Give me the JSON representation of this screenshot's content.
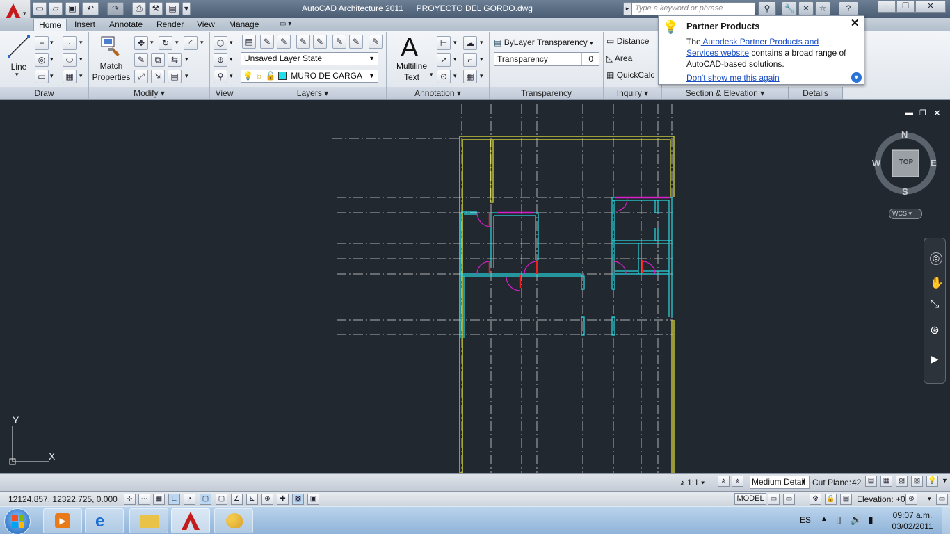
{
  "window": {
    "title": "AutoCAD Architecture 2011",
    "document": "PROYECTO DEL GORDO.dwg",
    "search_placeholder": "Type a keyword or phrase"
  },
  "tabs": [
    {
      "label": "Home"
    },
    {
      "label": "Insert"
    },
    {
      "label": "Annotate"
    },
    {
      "label": "Render"
    },
    {
      "label": "View"
    },
    {
      "label": "Manage"
    }
  ],
  "ribbon": {
    "panels": {
      "draw": "Draw",
      "modify": "Modify",
      "view": "View",
      "layers": "Layers",
      "annotation": "Annotation",
      "transparency": "Transparency",
      "inquiry": "Inquiry",
      "section": "Section & Elevation",
      "details": "Details"
    },
    "line_label": "Line",
    "match_label_1": "Match",
    "match_label_2": "Properties",
    "layer_state": "Unsaved Layer State",
    "current_layer": "MURO DE CARGA",
    "layer_color": "#22e0e8",
    "multiline_1": "Multiline",
    "multiline_2": "Text",
    "transparency_dd": "ByLayer Transparency",
    "transparency_label": "Transparency",
    "transparency_value": "0",
    "distance": "Distance",
    "area": "Area",
    "quickcalc": "QuickCalc"
  },
  "tooltip": {
    "title": "Partner Products",
    "text_before": "The",
    "link_text": " Autodesk Partner Products and Services website",
    "text_after": " contains a broad range of AutoCAD-based solutions.",
    "dont_show": "Don't show me this again"
  },
  "viewcube": {
    "north": "N",
    "south": "S",
    "east": "E",
    "west": "W",
    "face": "TOP",
    "ucs": "WCS"
  },
  "ucs_icon": {
    "x": "X",
    "y": "Y"
  },
  "viewport_status": {
    "scale": "1:1",
    "detail": "Medium Detail",
    "cut_plane_label": "Cut Plane:",
    "cut_plane_value": "42"
  },
  "status_bar": {
    "coordinates": "12124.857, 12322.725, 0.000",
    "model": "MODEL",
    "elevation_label": "Elevation:",
    "elevation_value": "+0"
  },
  "taskbar": {
    "language": "ES",
    "time": "09:07 a.m.",
    "date": "03/02/2011"
  },
  "colors": {
    "background": "#212830",
    "walls": "#e6e63a",
    "partitions": "#29d8e0",
    "doors": "#d81ec8",
    "jambs": "#e82020",
    "grid": "#b5b5b5"
  }
}
